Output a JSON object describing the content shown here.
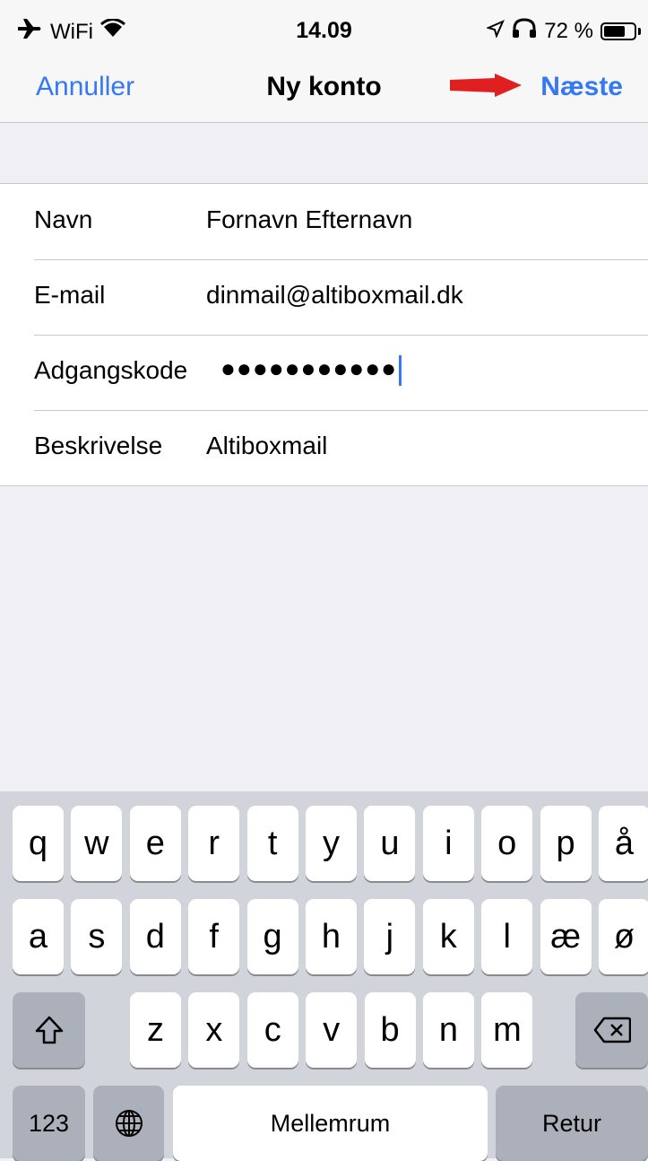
{
  "status_bar": {
    "carrier": "WiFi",
    "time": "14.09",
    "battery_text": "72 %",
    "battery_level": 0.72,
    "icons": [
      "airplane-icon",
      "wifi-icon",
      "location-icon",
      "headphones-icon",
      "battery-icon"
    ]
  },
  "nav": {
    "cancel_label": "Annuller",
    "title": "Ny konto",
    "next_label": "Næste",
    "accent_color": "#3478f6",
    "arrow_color": "#e02020"
  },
  "form": {
    "rows": [
      {
        "label": "Navn",
        "value": "Fornavn Efternavn"
      },
      {
        "label": "E-mail",
        "value": "dinmail@altiboxmail.dk"
      },
      {
        "label": "Adgangskode",
        "value": "●●●●●●●●●●●"
      },
      {
        "label": "Beskrivelse",
        "value": "Altiboxmail"
      }
    ]
  },
  "keyboard": {
    "row1": [
      "q",
      "w",
      "e",
      "r",
      "t",
      "y",
      "u",
      "i",
      "o",
      "p",
      "å"
    ],
    "row2": [
      "a",
      "s",
      "d",
      "f",
      "g",
      "h",
      "j",
      "k",
      "l",
      "æ",
      "ø"
    ],
    "row3": [
      "z",
      "x",
      "c",
      "v",
      "b",
      "n",
      "m"
    ],
    "numbers_label": "123",
    "space_label": "Mellemrum",
    "return_label": "Retur"
  }
}
